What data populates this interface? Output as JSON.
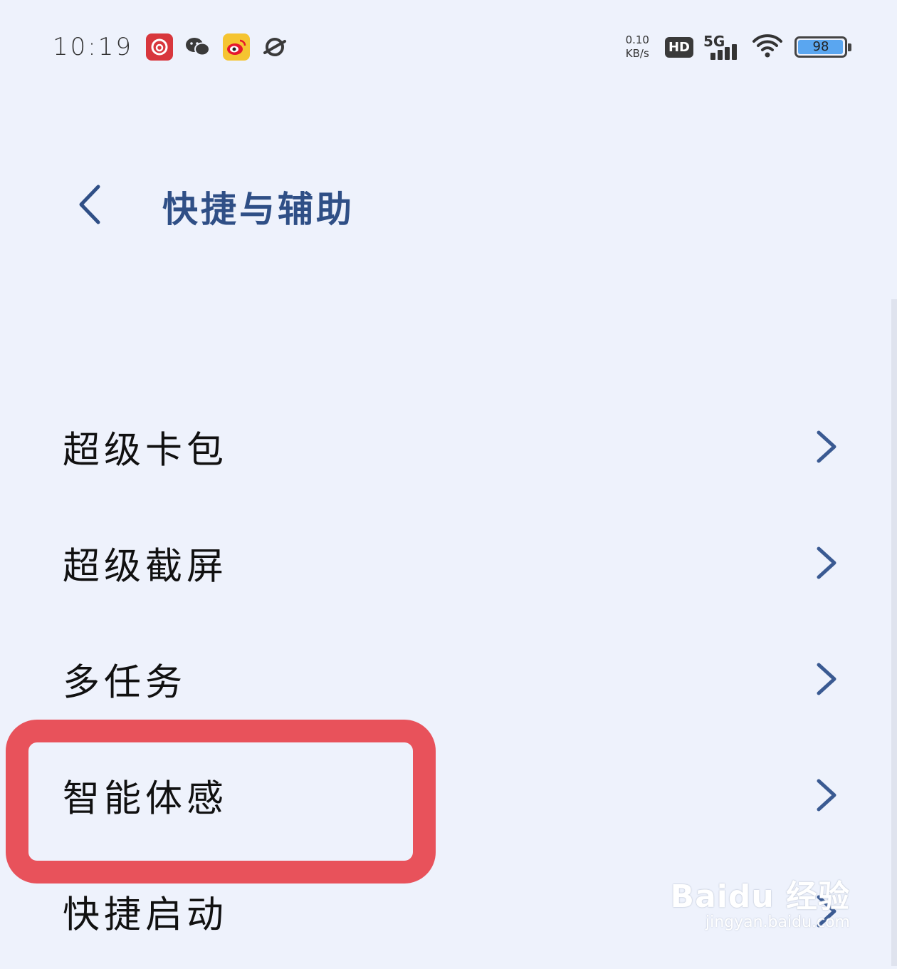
{
  "status_bar": {
    "time": "10:19",
    "net_speed_value": "0.10",
    "net_speed_unit": "KB/s",
    "hd_label": "HD",
    "network_label": "5G",
    "battery_level": "98",
    "battery_fraction": 0.98,
    "app_icons": [
      "netease-music-icon",
      "wechat-icon",
      "weibo-icon",
      "planet-icon"
    ]
  },
  "header": {
    "title": "快捷与辅助"
  },
  "menu": {
    "items": [
      {
        "label": "超级卡包"
      },
      {
        "label": "超级截屏"
      },
      {
        "label": "多任务"
      },
      {
        "label": "智能体感"
      },
      {
        "label": "快捷启动"
      }
    ]
  },
  "highlight": {
    "color": "#e8525b",
    "target": "智能体感"
  },
  "watermark": {
    "logo": "Baidu 经验",
    "url": "jingyan.baidu.com"
  },
  "colors": {
    "background": "#eef2fc",
    "accent": "#2f4f86",
    "chevron": "#3a5a92"
  }
}
